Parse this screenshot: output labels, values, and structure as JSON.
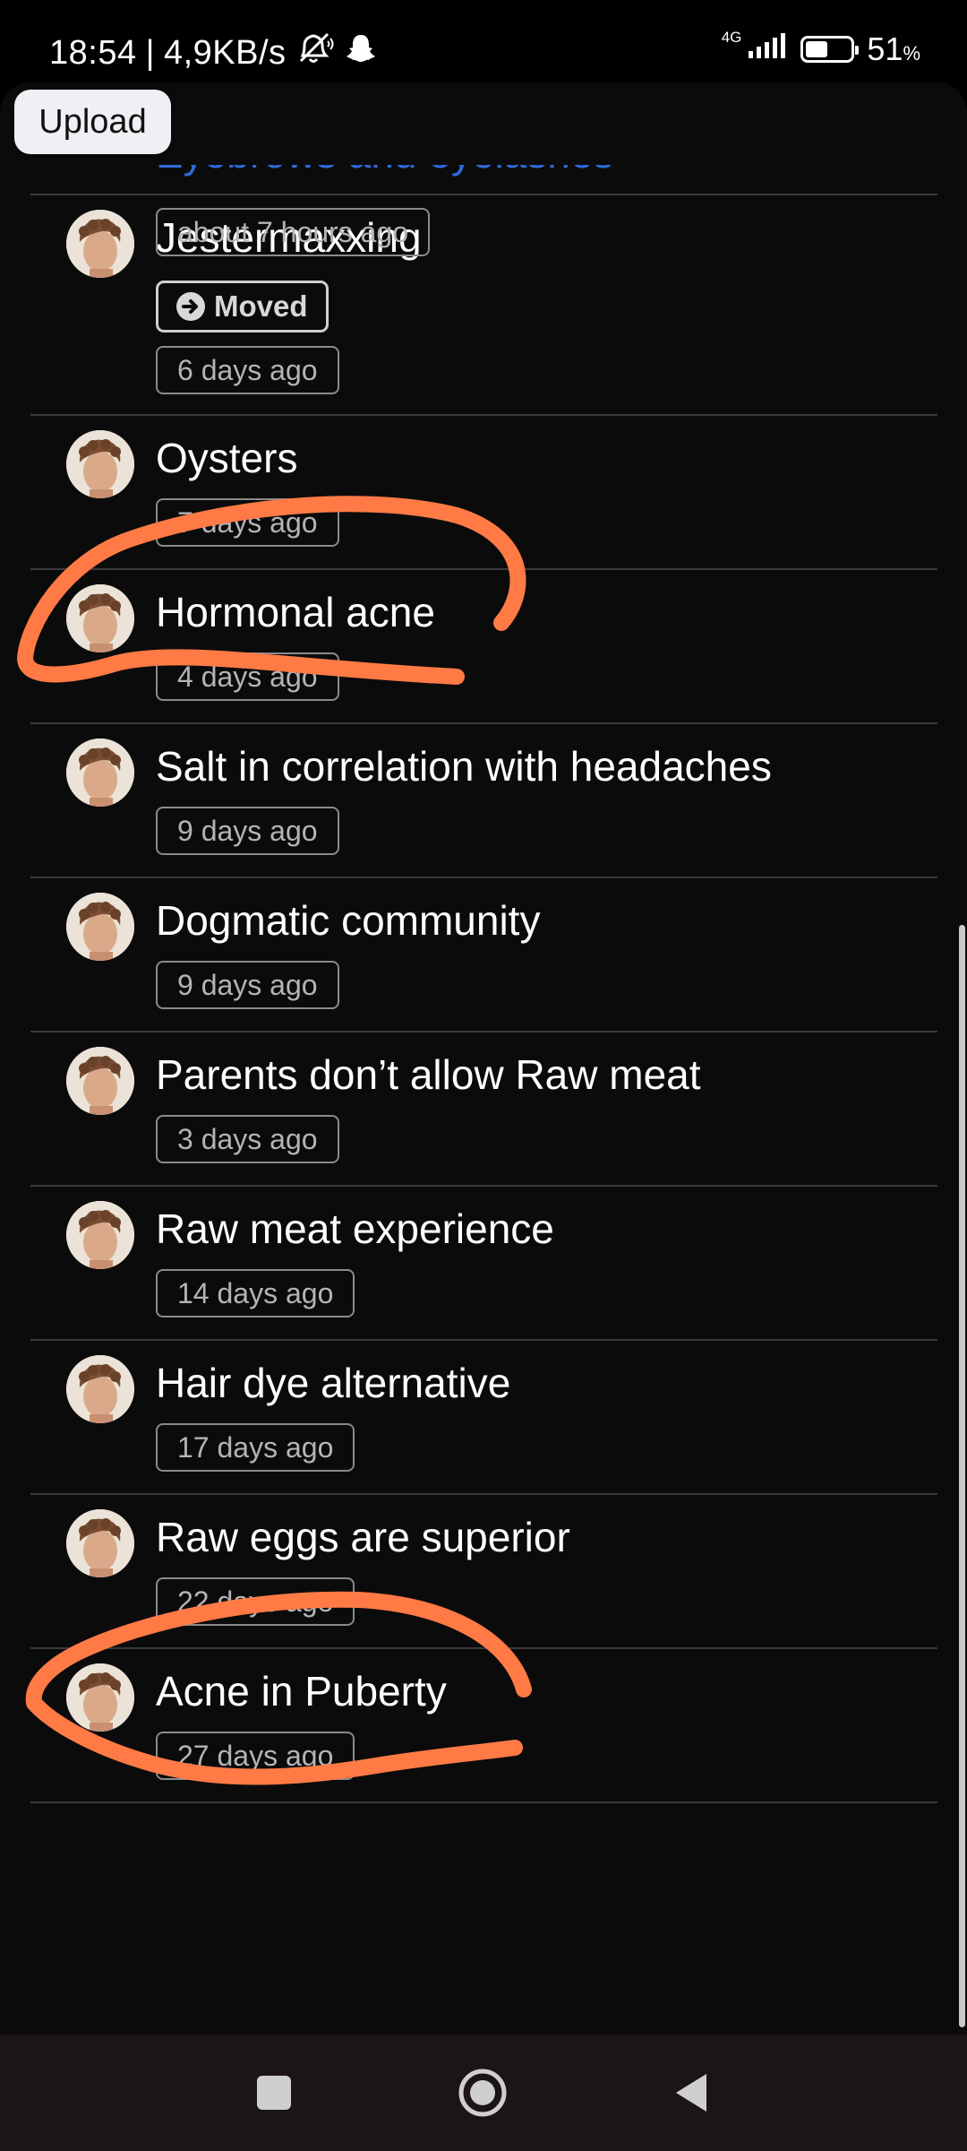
{
  "status_bar": {
    "time": "18:54",
    "separator": "|",
    "network_speed": "4,9KB/s",
    "network_type": "4G",
    "battery_percent": "51",
    "battery_percent_sign": "%",
    "battery_level": 0.51
  },
  "upload_label": "Upload",
  "partial_item": {
    "title": "Eyebrows and eyelashes",
    "time": "about 7 hours ago"
  },
  "items": [
    {
      "title": "Jestermaxxing",
      "badge": "Moved",
      "time": "6 days ago"
    },
    {
      "title": "Oysters",
      "time": "7 days ago"
    },
    {
      "title": "Hormonal acne",
      "time": "4 days ago"
    },
    {
      "title": "Salt in correlation with headaches",
      "time": "9 days ago"
    },
    {
      "title": "Dogmatic community",
      "time": "9 days ago"
    },
    {
      "title": "Parents don’t allow Raw meat",
      "time": "3 days ago"
    },
    {
      "title": "Raw meat experience",
      "time": "14 days ago"
    },
    {
      "title": "Hair dye alternative",
      "time": "17 days ago"
    },
    {
      "title": "Raw eggs are superior",
      "time": "22 days ago"
    },
    {
      "title": "Acne in Puberty",
      "time": "27 days ago"
    }
  ],
  "colors": {
    "background": "#0b0b0c",
    "link_blue": "#2f6bd8",
    "annotation_orange": "#ff7a45",
    "divider": "#3a3a3c",
    "nav_bar": "#1c1516"
  }
}
